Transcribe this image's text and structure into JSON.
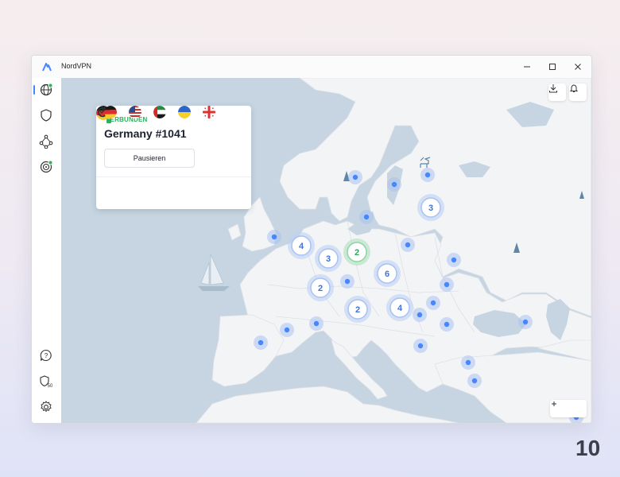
{
  "window": {
    "title": "NordVPN",
    "controls": [
      "minimize",
      "maximize",
      "close"
    ]
  },
  "sidebar": {
    "items": [
      {
        "name": "globe-icon",
        "active": true,
        "badge": "green-dot"
      },
      {
        "name": "shield-icon"
      },
      {
        "name": "meshnet-icon"
      },
      {
        "name": "target-icon",
        "badge": "green-dot"
      },
      {
        "name": "help-icon"
      },
      {
        "name": "threat-shield-icon",
        "badge_text": "50"
      },
      {
        "name": "settings-icon"
      }
    ]
  },
  "panel": {
    "status": "VERBUNDEN",
    "server": "Germany #1041",
    "flag": "germany-flag-icon",
    "pause_label": "Pausieren",
    "recent_flags": [
      "germany-flag-icon",
      "usa-flag-icon",
      "uae-flag-icon",
      "ukraine-flag-icon",
      "georgia-flag-icon"
    ],
    "expand": "chevron-down-icon"
  },
  "map": {
    "clusters": [
      "4",
      "3",
      "2",
      "6",
      "2",
      "2",
      "4",
      "3"
    ],
    "active_cluster": "2"
  },
  "colors": {
    "accent": "#4687ff",
    "connected": "#2fae5d",
    "water": "#c6d5e1",
    "land": "#f3f4f6"
  },
  "brand": {
    "mark": "10"
  }
}
